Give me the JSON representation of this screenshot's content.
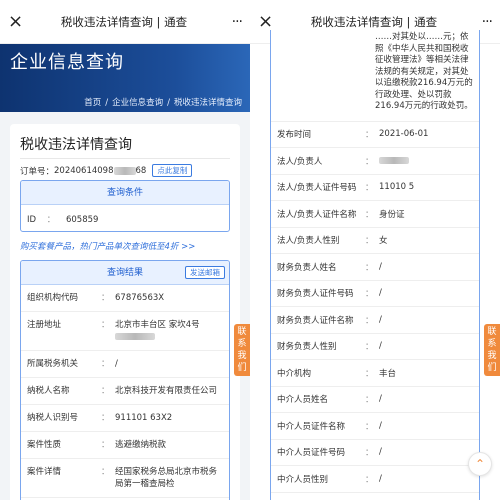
{
  "wechat": {
    "close_icon": "×",
    "title": "税收违法详情查询 | 通查",
    "more_icon": "···"
  },
  "banner": {
    "title": "企业信息查询",
    "breadcrumb": [
      "首页",
      "企业信息查询",
      "税收违法详情查询"
    ],
    "separator": "/"
  },
  "card": {
    "title": "税收违法详情查询",
    "order_label": "订单号：",
    "order_prefix": "20240614098",
    "order_suffix": "68",
    "copy_button": "点此复制"
  },
  "query": {
    "header": "查询条件",
    "id_label": "ID",
    "id_value": "605859"
  },
  "promo": "购买套餐产品，热门产品单次查询低至4折 >>",
  "result": {
    "header": "查询结果",
    "mail_button": "发送邮箱",
    "rows": [
      {
        "label": "组织机构代码",
        "value": "67876563X"
      },
      {
        "label": "注册地址",
        "value": "北京市丰台区 家坎4号"
      },
      {
        "label": "所属税务机关",
        "value": "/"
      },
      {
        "label": "纳税人名称",
        "value": "北京科技开发有限责任公司"
      },
      {
        "label": "纳税人识别号",
        "value": "911101 63X2"
      },
      {
        "label": "案件性质",
        "value": "逃避缴纳税款"
      },
      {
        "label": "案件详情",
        "value": "经国家税务总局北京市税务局第一稽查局检"
      }
    ]
  },
  "right": {
    "detail_tail": "……对其处以……元；依照《中华人民共和国税收征收管理法》等相关法律法规的有关规定，对其处以追缴税款216.94万元的行政处理、处以罚款216.94万元的行政处罚。",
    "rows": [
      {
        "label": "发布时间",
        "value": "2021-06-01"
      },
      {
        "label": "法人/负责人",
        "value": ""
      },
      {
        "label": "法人/负责人证件号码",
        "value": "11010 5"
      },
      {
        "label": "法人/负责人证件名称",
        "value": "身份证"
      },
      {
        "label": "法人/负责人性别",
        "value": "女"
      },
      {
        "label": "财务负责人姓名",
        "value": "/"
      },
      {
        "label": "财务负责人证件号码",
        "value": "/"
      },
      {
        "label": "财务负责人证件名称",
        "value": "/"
      },
      {
        "label": "财务负责人性别",
        "value": "/"
      },
      {
        "label": "中介机构",
        "value": "丰台"
      },
      {
        "label": "中介人员姓名",
        "value": "/"
      },
      {
        "label": "中介人员证件名称",
        "value": "/"
      },
      {
        "label": "中介人员证件号码",
        "value": "/"
      },
      {
        "label": "中介人员性别",
        "value": "/"
      }
    ]
  },
  "side_tab": "联系我们",
  "back_to_top_icon": "⌃",
  "colors": {
    "accent": "#1f5fcf",
    "banner": "#1c4e9a",
    "side_tab": "#f08a3c"
  }
}
